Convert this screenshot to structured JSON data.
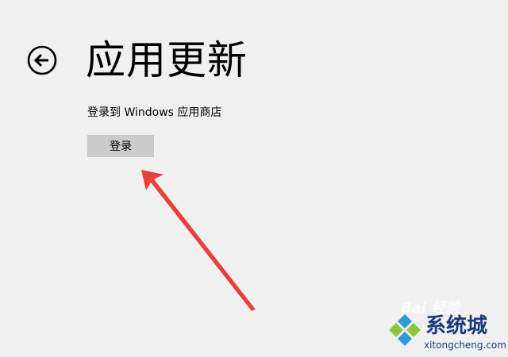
{
  "header": {
    "back_icon": "back-arrow-circle-icon",
    "title": "应用更新"
  },
  "signin": {
    "caption": "登录到 Windows 应用商店",
    "button_label": "登录"
  },
  "annotation": {
    "arrow_color": "#e8403a"
  },
  "watermark": {
    "baidu_text": "Bai 经验",
    "site_name": "系统城",
    "site_url": "xitongcheng.com",
    "logo_icon": "diamond-logo-icon"
  },
  "colors": {
    "background": "#f0f0f0",
    "button_bg": "#cccccc",
    "watermark_text": "#1a3b7a"
  }
}
